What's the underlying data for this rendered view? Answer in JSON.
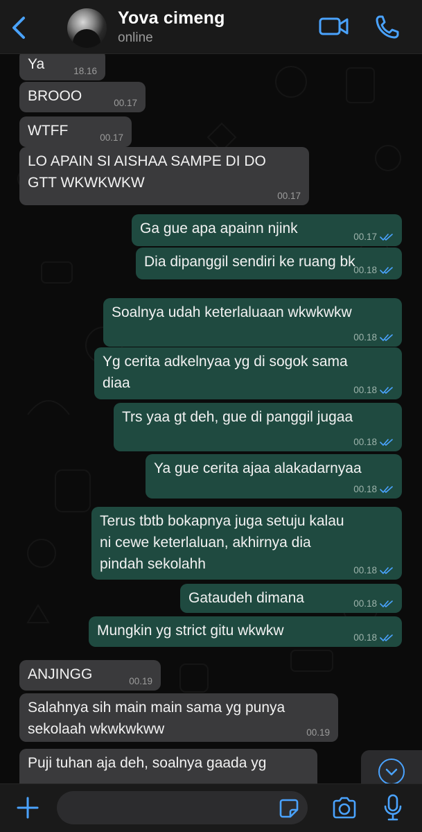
{
  "header": {
    "contact_name": "Yova cimeng",
    "status": "online",
    "icons": [
      "back-chevron-icon",
      "avatar",
      "video-camera-icon",
      "phone-icon"
    ]
  },
  "colors": {
    "accent": "#4aa3ff",
    "incoming_bubble": "#3a3a3c",
    "outgoing_bubble": "#1f4a40",
    "background": "#0b0b0b"
  },
  "messages": [
    {
      "direction": "in",
      "lines": [
        "Ya"
      ],
      "time": "18.16"
    },
    {
      "direction": "in",
      "lines": [
        "BROOO"
      ],
      "time": "00.17"
    },
    {
      "direction": "in",
      "lines": [
        "WTFF"
      ],
      "time": "00.17"
    },
    {
      "direction": "in",
      "lines": [
        "LO APAIN SI AISHAA SAMPE DI DO",
        "GTT WKWKWKW"
      ],
      "time": "00.17"
    },
    {
      "direction": "out",
      "lines": [
        "Ga gue apa apainn njink"
      ],
      "time": "00.17",
      "read": true
    },
    {
      "direction": "out",
      "lines": [
        "Dia dipanggil sendiri ke ruang bk"
      ],
      "time": "00.18",
      "read": true
    },
    {
      "direction": "out",
      "lines": [
        "Soalnya udah keterlaluaan wkwkwkw"
      ],
      "time": "00.18",
      "read": true
    },
    {
      "direction": "out",
      "lines": [
        "Yg cerita adkelnyaa yg di sogok sama",
        "diaa"
      ],
      "time": "00.18",
      "read": true
    },
    {
      "direction": "out",
      "lines": [
        "Trs yaa gt deh, gue di panggil jugaa"
      ],
      "time": "00.18",
      "read": true
    },
    {
      "direction": "out",
      "lines": [
        "Ya gue cerita ajaa alakadarnyaa"
      ],
      "time": "00.18",
      "read": true
    },
    {
      "direction": "out",
      "lines": [
        "Terus tbtb bokapnya juga setuju kalau",
        "ni cewe keterlaluan, akhirnya dia",
        "pindah sekolahh"
      ],
      "time": "00.18",
      "read": true
    },
    {
      "direction": "out",
      "lines": [
        "Gataudeh dimana"
      ],
      "time": "00.18",
      "read": true
    },
    {
      "direction": "out",
      "lines": [
        "Mungkin yg strict gitu wkwkw"
      ],
      "time": "00.18",
      "read": true
    },
    {
      "direction": "in",
      "lines": [
        "ANJINGG"
      ],
      "time": "00.19"
    },
    {
      "direction": "in",
      "lines": [
        "Salahnya sih main main sama yg punya",
        "sekolaah wkwkwkww"
      ],
      "time": "00.19"
    },
    {
      "direction": "in",
      "lines": [
        "Puji tuhan aja deh, soalnya gaada yg"
      ],
      "time": ""
    }
  ],
  "input": {
    "placeholder": "",
    "value": "",
    "icons": [
      "plus-icon",
      "sticker-icon",
      "camera-icon",
      "microphone-icon"
    ]
  },
  "scroll_button": {
    "icon": "chevron-down-icon"
  }
}
